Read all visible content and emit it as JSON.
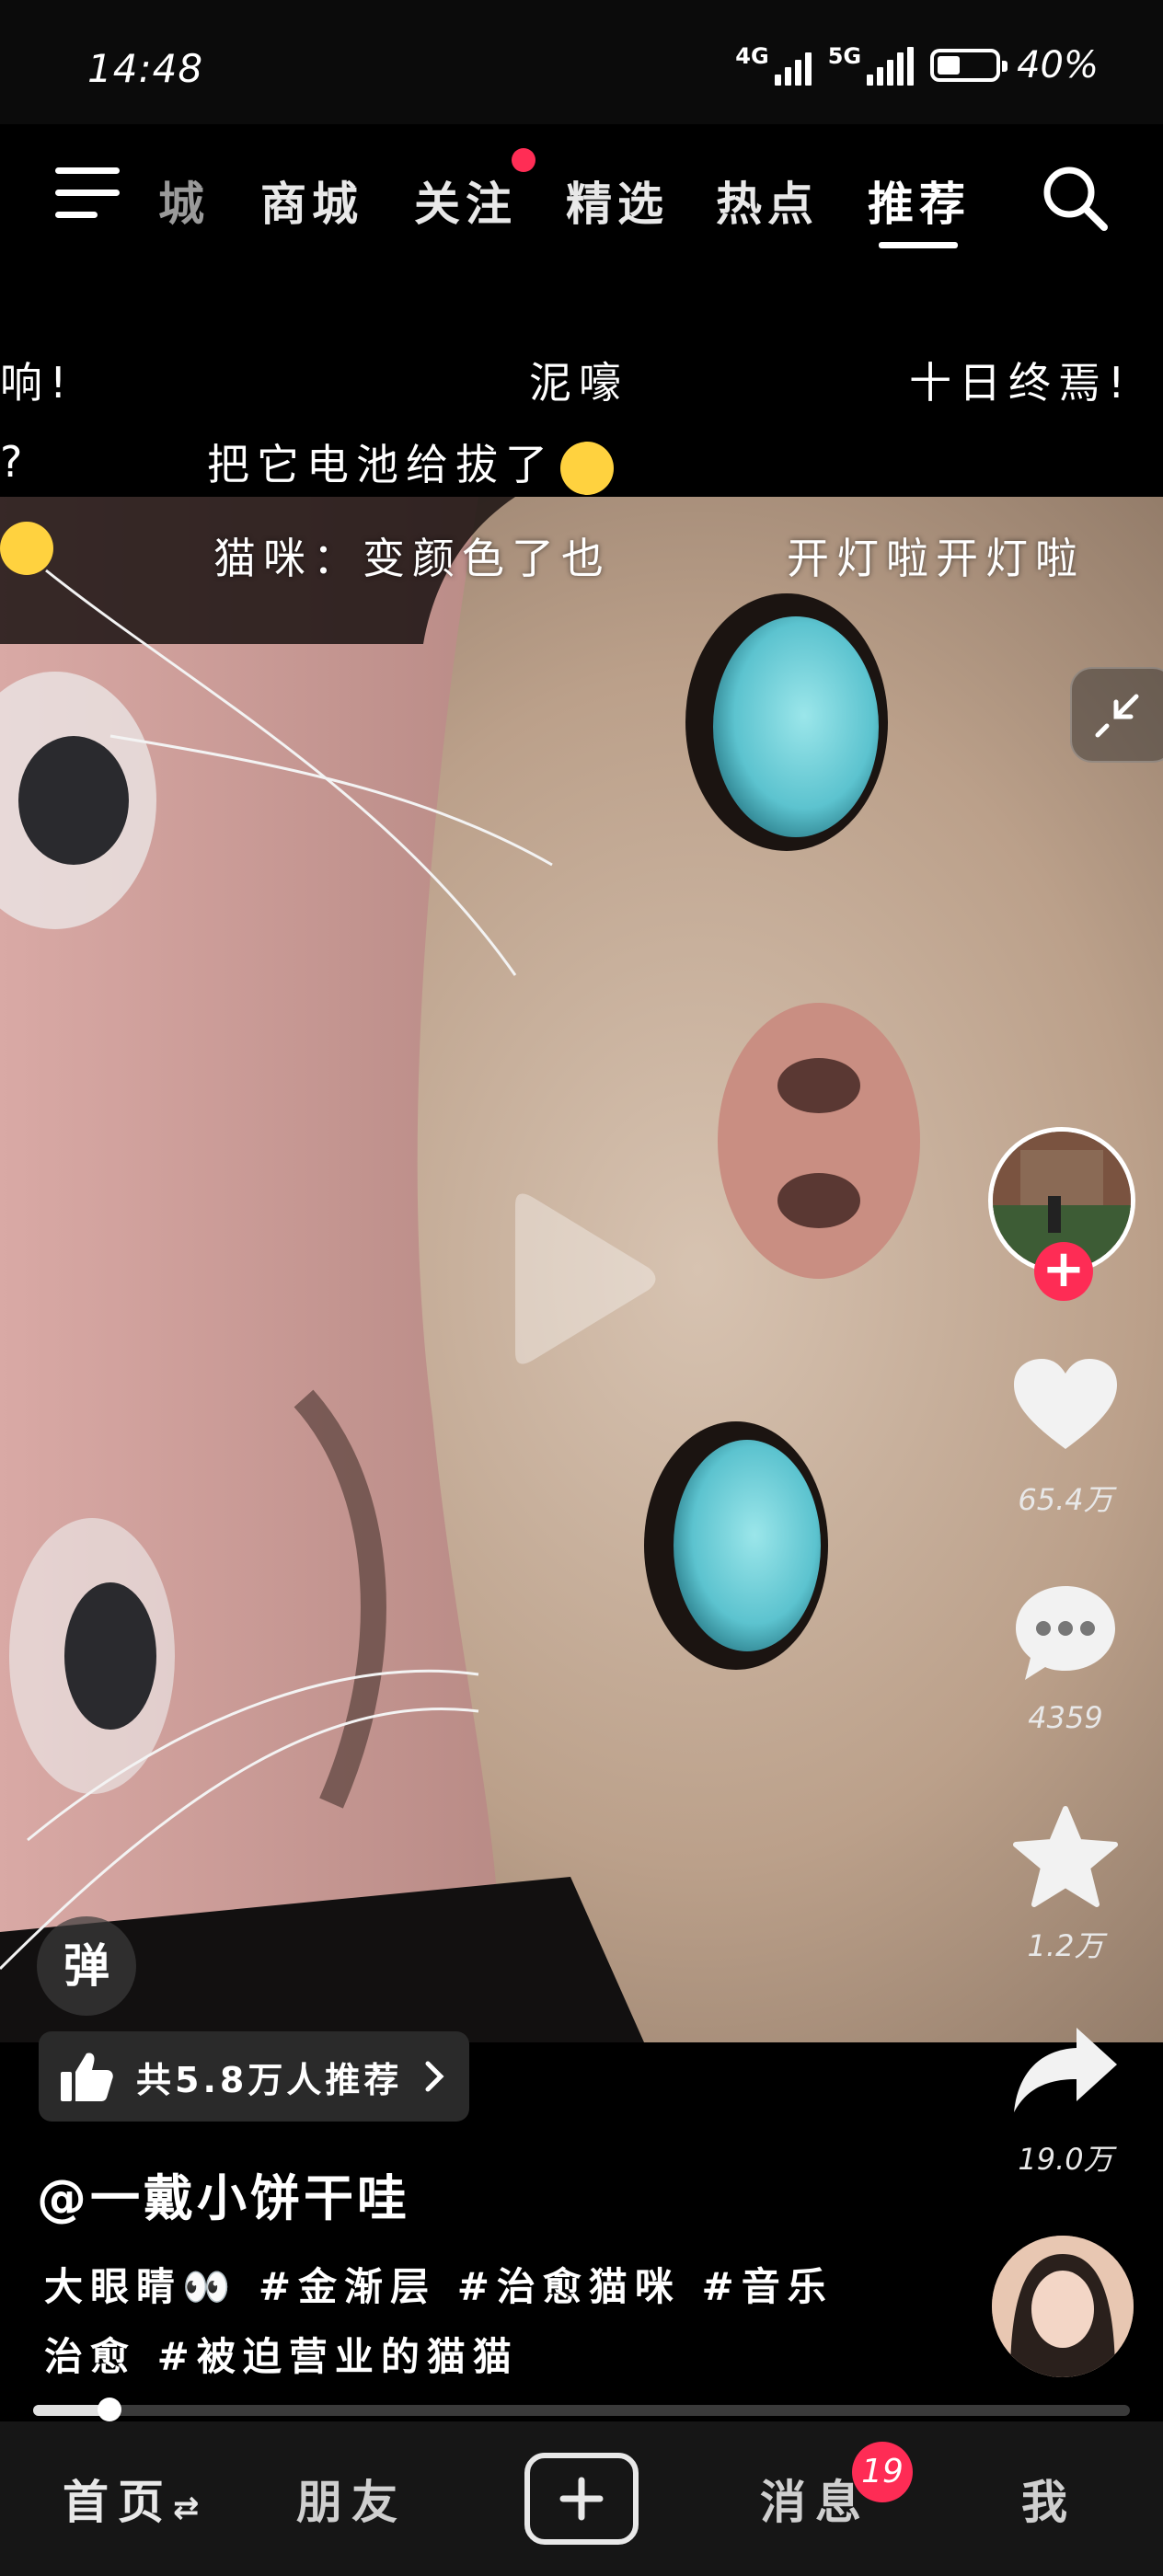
{
  "status_bar": {
    "time": "14:48",
    "network_1": "4G",
    "network_2": "5G",
    "battery_text": "40%",
    "battery_level": 0.4
  },
  "top_nav": {
    "tabs": [
      {
        "label": "城",
        "active": false
      },
      {
        "label": "商城",
        "active": false
      },
      {
        "label": "关注",
        "active": false,
        "has_dot": true
      },
      {
        "label": "精选",
        "active": false
      },
      {
        "label": "热点",
        "active": false
      },
      {
        "label": "推荐",
        "active": true
      }
    ],
    "menu_icon": "hamburger-icon",
    "search_icon": "search-icon"
  },
  "danmaku": {
    "row1": [
      "响!",
      "泥嚎",
      "十日终焉!"
    ],
    "row2": [
      "?",
      "把它电池给拔了"
    ],
    "row3": [
      "猫咪：变颜色了也",
      "开灯啦开灯啦"
    ]
  },
  "actions": {
    "likes": "65.4万",
    "comments": "4359",
    "favorites": "1.2万",
    "shares": "19.0万",
    "follow_plus": "+",
    "danmaku_toggle": "弹"
  },
  "video": {
    "recommend_text": "共5.8万人推荐",
    "author": "@一戴小饼干哇",
    "description_line1": "大眼睛👀 #金渐层 #治愈猫咪 #音乐",
    "description_line2": "治愈 #被迫营业的猫猫",
    "progress": 0.07
  },
  "bottom_nav": {
    "home": "首页",
    "friends": "朋友",
    "messages": "消息",
    "messages_badge": "19",
    "me": "我"
  },
  "colors": {
    "accent": "#fe2c55",
    "background": "#000000",
    "nav_bar": "#161616"
  }
}
